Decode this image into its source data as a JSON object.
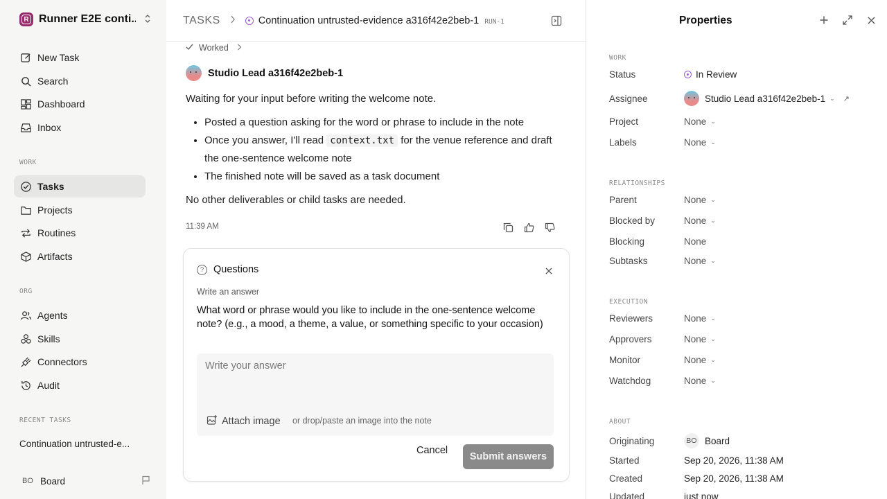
{
  "workspace": {
    "logo_letter": "R",
    "name": "Runner E2E conti..."
  },
  "sidebar": {
    "primary": [
      {
        "label": "New Task",
        "icon": "edit-icon"
      },
      {
        "label": "Search",
        "icon": "search-icon"
      },
      {
        "label": "Dashboard",
        "icon": "dashboard-icon"
      },
      {
        "label": "Inbox",
        "icon": "inbox-icon"
      }
    ],
    "work_label": "WORK",
    "work": [
      {
        "label": "Tasks",
        "icon": "check-circle-icon",
        "active": true
      },
      {
        "label": "Projects",
        "icon": "folder-icon"
      },
      {
        "label": "Routines",
        "icon": "repeat-icon"
      },
      {
        "label": "Artifacts",
        "icon": "box-icon"
      }
    ],
    "org_label": "ORG",
    "org": [
      {
        "label": "Agents",
        "icon": "users-icon"
      },
      {
        "label": "Skills",
        "icon": "skills-icon"
      },
      {
        "label": "Connectors",
        "icon": "plug-icon"
      },
      {
        "label": "Audit",
        "icon": "history-icon"
      }
    ],
    "recent_label": "RECENT TASKS",
    "recent": [
      "Continuation untrusted-e..."
    ],
    "user": {
      "initials": "BO",
      "name": "Board"
    }
  },
  "header": {
    "root": "TASKS",
    "title": "Continuation untrusted-evidence a316f42e2beb-1",
    "run_id": "RUN-1"
  },
  "thread": {
    "worked_label": "Worked",
    "author": "Studio Lead a316f42e2beb-1",
    "intro": "Waiting for your input before writing the welcome note.",
    "bullets": {
      "b1": "Posted a question asking for the word or phrase to include in the note",
      "b2_pre": "Once you answer, I'll read",
      "b2_code": "context.txt",
      "b2_post": "for the venue reference and draft the one-sentence welcome note",
      "b3": "The finished note will be saved as a task document"
    },
    "outro": "No other deliverables or child tasks are needed.",
    "time": "11:39 AM"
  },
  "questions": {
    "title": "Questions",
    "subtitle": "Write an answer",
    "question": "What word or phrase would you like to include in the one-sentence welcome note? (e.g., a mood, a theme, a value, or something specific to your occasion)",
    "answer_value": "",
    "answer_placeholder": "Write your answer",
    "attach_label": "Attach image",
    "attach_hint": "or drop/paste an image into the note",
    "cancel_label": "Cancel",
    "submit_label": "Submit answers"
  },
  "properties": {
    "title": "Properties",
    "work_label": "WORK",
    "status_label": "Status",
    "status_value": "In Review",
    "assignee_label": "Assignee",
    "assignee_value": "Studio Lead a316f42e2beb-1",
    "project_label": "Project",
    "project_value": "None",
    "labels_label": "Labels",
    "labels_value": "None",
    "relationships_label": "RELATIONSHIPS",
    "parent_label": "Parent",
    "parent_value": "None",
    "blocked_by_label": "Blocked by",
    "blocked_by_value": "None",
    "blocking_label": "Blocking",
    "blocking_value": "None",
    "subtasks_label": "Subtasks",
    "subtasks_value": "None",
    "execution_label": "EXECUTION",
    "reviewers_label": "Reviewers",
    "reviewers_value": "None",
    "approvers_label": "Approvers",
    "approvers_value": "None",
    "monitor_label": "Monitor",
    "monitor_value": "None",
    "watchdog_label": "Watchdog",
    "watchdog_value": "None",
    "about_label": "ABOUT",
    "originating_label": "Originating",
    "originating_initials": "BO",
    "originating_value": "Board",
    "started_label": "Started",
    "started_value": "Sep 20, 2026, 11:38 AM",
    "created_label": "Created",
    "created_value": "Sep 20, 2026, 11:38 AM",
    "updated_label": "Updated",
    "updated_value": "just now"
  },
  "colors": {
    "accent_status": "#9a5bd1",
    "workspace_logo": "#9a2a6e",
    "submit_disabled": "#8a8a8a",
    "sidebar_bg": "#f6f6f5"
  }
}
